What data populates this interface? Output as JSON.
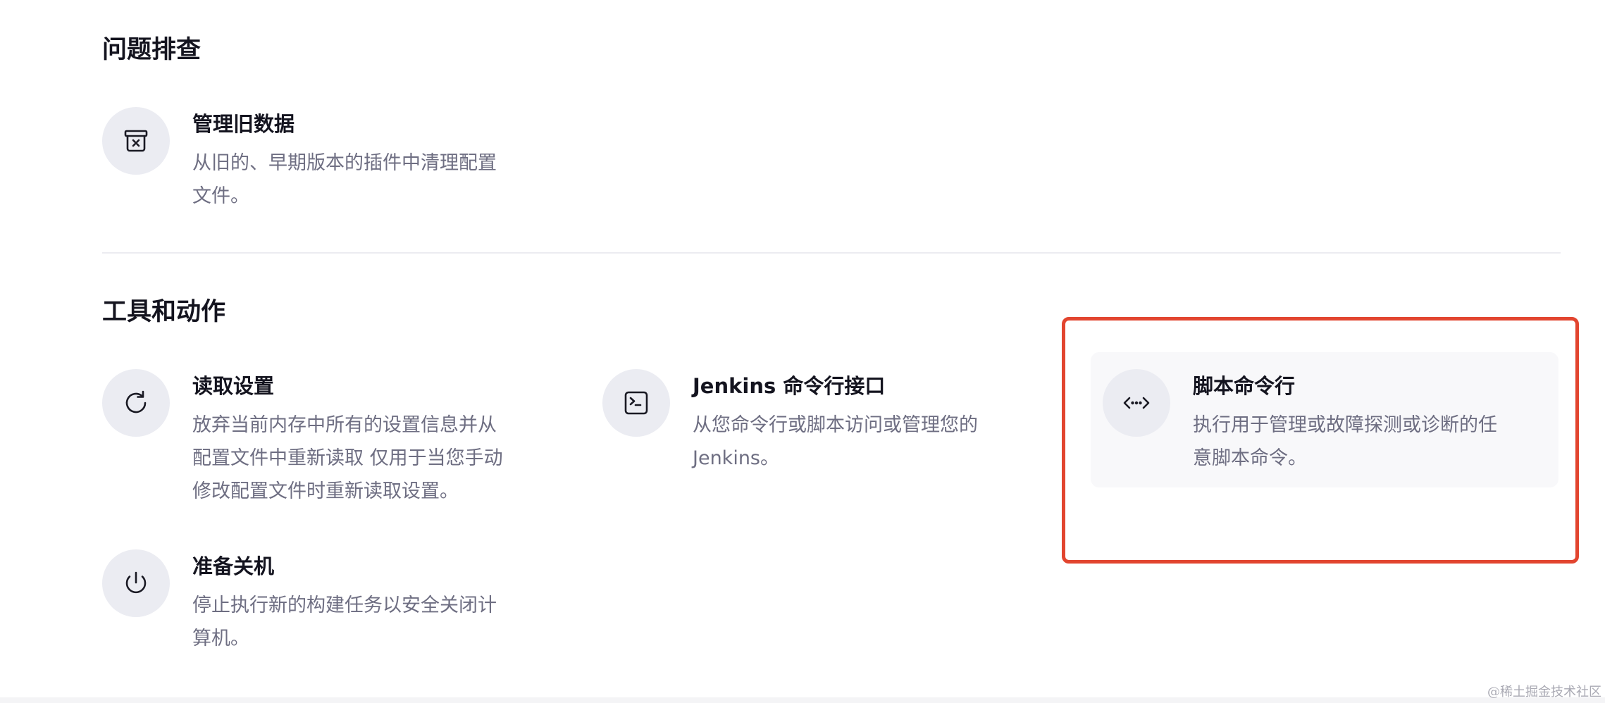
{
  "sections": {
    "troubleshooting": {
      "title": "问题排查",
      "items": [
        {
          "icon": "archive-x-icon",
          "title": "管理旧数据",
          "desc_lines": [
            "从旧的、早期版本的插件中清理配置",
            "文件。"
          ]
        }
      ]
    },
    "tools": {
      "title": "工具和动作",
      "items": [
        {
          "icon": "reload-icon",
          "title": "读取设置",
          "desc_lines": [
            "放弃当前内存中所有的设置信息并从",
            "配置文件中重新读取 仅用于当您手动",
            "修改配置文件时重新读取设置。"
          ]
        },
        {
          "icon": "terminal-icon",
          "title": "Jenkins 命令行接口",
          "desc_lines": [
            "从您命令行或脚本访问或管理您的",
            "Jenkins。"
          ]
        },
        {
          "icon": "code-icon",
          "title": "脚本命令行",
          "desc_lines": [
            "执行用于管理或故障探测或诊断的任",
            "意脚本命令。"
          ]
        },
        {
          "icon": "power-icon",
          "title": "准备关机",
          "desc_lines": [
            "停止执行新的构建任务以安全关闭计",
            "算机。"
          ]
        }
      ]
    }
  },
  "watermark": "@稀土掘金技术社区",
  "colors": {
    "title": "#14141f",
    "description": "#6e6e82",
    "icon_bg": "#ebecf2",
    "highlight_border": "#e2452f"
  }
}
